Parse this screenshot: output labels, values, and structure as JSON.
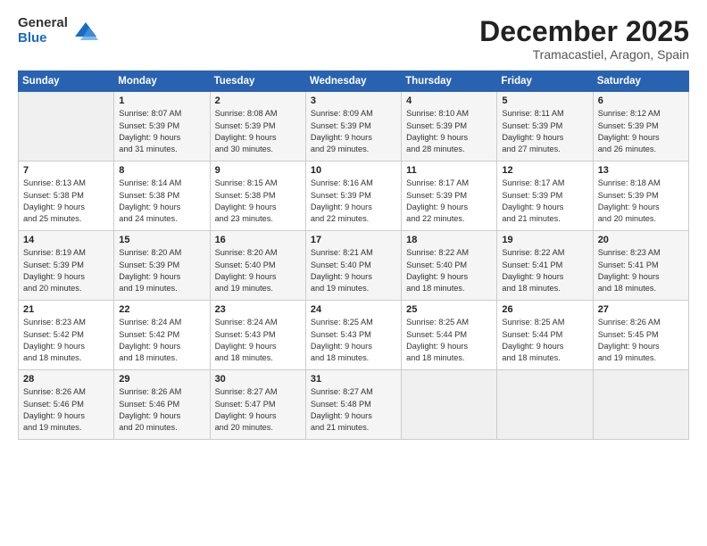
{
  "logo": {
    "general": "General",
    "blue": "Blue"
  },
  "title": "December 2025",
  "location": "Tramacastiel, Aragon, Spain",
  "weekdays": [
    "Sunday",
    "Monday",
    "Tuesday",
    "Wednesday",
    "Thursday",
    "Friday",
    "Saturday"
  ],
  "weeks": [
    [
      {
        "day": "",
        "info": ""
      },
      {
        "day": "1",
        "info": "Sunrise: 8:07 AM\nSunset: 5:39 PM\nDaylight: 9 hours\nand 31 minutes."
      },
      {
        "day": "2",
        "info": "Sunrise: 8:08 AM\nSunset: 5:39 PM\nDaylight: 9 hours\nand 30 minutes."
      },
      {
        "day": "3",
        "info": "Sunrise: 8:09 AM\nSunset: 5:39 PM\nDaylight: 9 hours\nand 29 minutes."
      },
      {
        "day": "4",
        "info": "Sunrise: 8:10 AM\nSunset: 5:39 PM\nDaylight: 9 hours\nand 28 minutes."
      },
      {
        "day": "5",
        "info": "Sunrise: 8:11 AM\nSunset: 5:39 PM\nDaylight: 9 hours\nand 27 minutes."
      },
      {
        "day": "6",
        "info": "Sunrise: 8:12 AM\nSunset: 5:39 PM\nDaylight: 9 hours\nand 26 minutes."
      }
    ],
    [
      {
        "day": "7",
        "info": "Sunrise: 8:13 AM\nSunset: 5:38 PM\nDaylight: 9 hours\nand 25 minutes."
      },
      {
        "day": "8",
        "info": "Sunrise: 8:14 AM\nSunset: 5:38 PM\nDaylight: 9 hours\nand 24 minutes."
      },
      {
        "day": "9",
        "info": "Sunrise: 8:15 AM\nSunset: 5:38 PM\nDaylight: 9 hours\nand 23 minutes."
      },
      {
        "day": "10",
        "info": "Sunrise: 8:16 AM\nSunset: 5:39 PM\nDaylight: 9 hours\nand 22 minutes."
      },
      {
        "day": "11",
        "info": "Sunrise: 8:17 AM\nSunset: 5:39 PM\nDaylight: 9 hours\nand 22 minutes."
      },
      {
        "day": "12",
        "info": "Sunrise: 8:17 AM\nSunset: 5:39 PM\nDaylight: 9 hours\nand 21 minutes."
      },
      {
        "day": "13",
        "info": "Sunrise: 8:18 AM\nSunset: 5:39 PM\nDaylight: 9 hours\nand 20 minutes."
      }
    ],
    [
      {
        "day": "14",
        "info": "Sunrise: 8:19 AM\nSunset: 5:39 PM\nDaylight: 9 hours\nand 20 minutes."
      },
      {
        "day": "15",
        "info": "Sunrise: 8:20 AM\nSunset: 5:39 PM\nDaylight: 9 hours\nand 19 minutes."
      },
      {
        "day": "16",
        "info": "Sunrise: 8:20 AM\nSunset: 5:40 PM\nDaylight: 9 hours\nand 19 minutes."
      },
      {
        "day": "17",
        "info": "Sunrise: 8:21 AM\nSunset: 5:40 PM\nDaylight: 9 hours\nand 19 minutes."
      },
      {
        "day": "18",
        "info": "Sunrise: 8:22 AM\nSunset: 5:40 PM\nDaylight: 9 hours\nand 18 minutes."
      },
      {
        "day": "19",
        "info": "Sunrise: 8:22 AM\nSunset: 5:41 PM\nDaylight: 9 hours\nand 18 minutes."
      },
      {
        "day": "20",
        "info": "Sunrise: 8:23 AM\nSunset: 5:41 PM\nDaylight: 9 hours\nand 18 minutes."
      }
    ],
    [
      {
        "day": "21",
        "info": "Sunrise: 8:23 AM\nSunset: 5:42 PM\nDaylight: 9 hours\nand 18 minutes."
      },
      {
        "day": "22",
        "info": "Sunrise: 8:24 AM\nSunset: 5:42 PM\nDaylight: 9 hours\nand 18 minutes."
      },
      {
        "day": "23",
        "info": "Sunrise: 8:24 AM\nSunset: 5:43 PM\nDaylight: 9 hours\nand 18 minutes."
      },
      {
        "day": "24",
        "info": "Sunrise: 8:25 AM\nSunset: 5:43 PM\nDaylight: 9 hours\nand 18 minutes."
      },
      {
        "day": "25",
        "info": "Sunrise: 8:25 AM\nSunset: 5:44 PM\nDaylight: 9 hours\nand 18 minutes."
      },
      {
        "day": "26",
        "info": "Sunrise: 8:25 AM\nSunset: 5:44 PM\nDaylight: 9 hours\nand 18 minutes."
      },
      {
        "day": "27",
        "info": "Sunrise: 8:26 AM\nSunset: 5:45 PM\nDaylight: 9 hours\nand 19 minutes."
      }
    ],
    [
      {
        "day": "28",
        "info": "Sunrise: 8:26 AM\nSunset: 5:46 PM\nDaylight: 9 hours\nand 19 minutes."
      },
      {
        "day": "29",
        "info": "Sunrise: 8:26 AM\nSunset: 5:46 PM\nDaylight: 9 hours\nand 20 minutes."
      },
      {
        "day": "30",
        "info": "Sunrise: 8:27 AM\nSunset: 5:47 PM\nDaylight: 9 hours\nand 20 minutes."
      },
      {
        "day": "31",
        "info": "Sunrise: 8:27 AM\nSunset: 5:48 PM\nDaylight: 9 hours\nand 21 minutes."
      },
      {
        "day": "",
        "info": ""
      },
      {
        "day": "",
        "info": ""
      },
      {
        "day": "",
        "info": ""
      }
    ]
  ]
}
